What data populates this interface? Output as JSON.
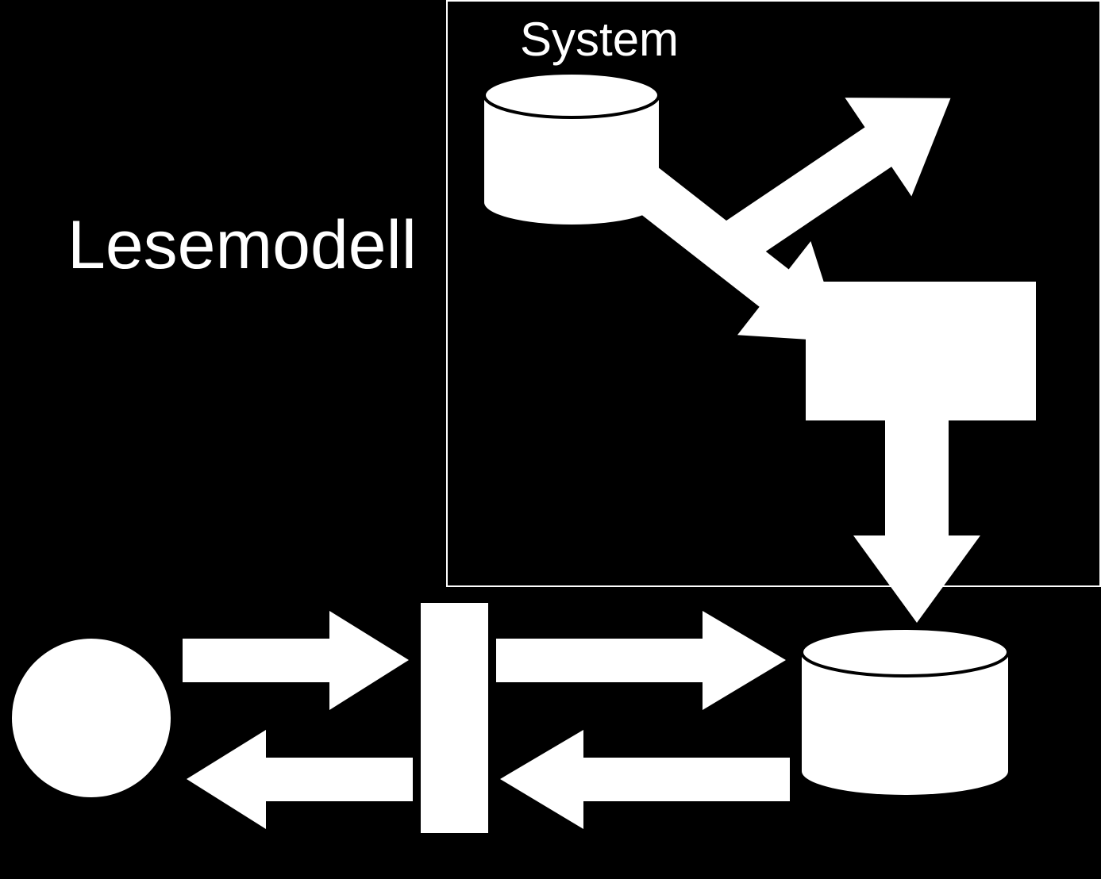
{
  "labels": {
    "lesemodell": "Lesemodell",
    "system": "System"
  },
  "diagram": {
    "nodes": [
      {
        "id": "user",
        "type": "circle",
        "role": "actor"
      },
      {
        "id": "api",
        "type": "rect-tall",
        "role": "interface"
      },
      {
        "id": "read-store",
        "type": "cylinder",
        "role": "datastore-read"
      },
      {
        "id": "process",
        "type": "rect-wide",
        "role": "processor"
      },
      {
        "id": "write-store",
        "type": "cylinder",
        "role": "datastore-write"
      }
    ],
    "edges": [
      {
        "from": "user",
        "to": "api",
        "dir": "both"
      },
      {
        "from": "api",
        "to": "read-store",
        "dir": "both"
      },
      {
        "from": "process",
        "to": "read-store",
        "dir": "forward"
      },
      {
        "from": "write-store",
        "to": "process",
        "dir": "both"
      }
    ],
    "regions": [
      {
        "id": "system",
        "label_key": "labels.system"
      }
    ],
    "title_label_key": "labels.lesemodell"
  }
}
